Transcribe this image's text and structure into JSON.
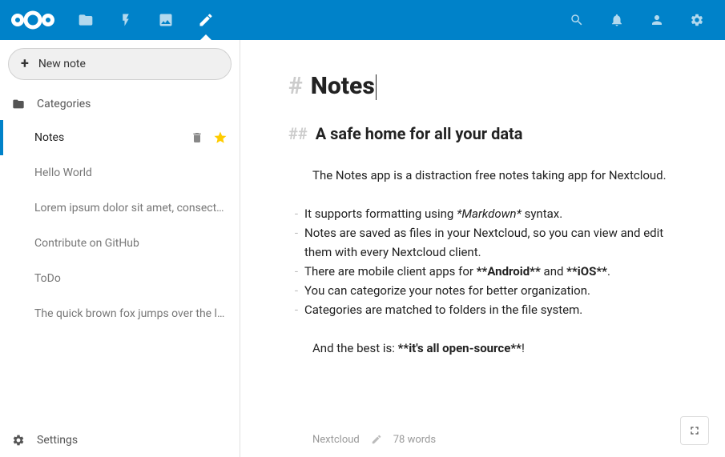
{
  "header": {
    "brand_color": "#0082c9"
  },
  "sidebar": {
    "new_note_label": "New note",
    "categories_label": "Categories",
    "settings_label": "Settings",
    "notes": [
      {
        "title": "Notes",
        "active": true,
        "starred": true
      },
      {
        "title": "Hello World"
      },
      {
        "title": "Lorem ipsum dolor sit amet, consectetur …"
      },
      {
        "title": "Contribute on GitHub"
      },
      {
        "title": "ToDo"
      },
      {
        "title": "The quick brown fox jumps over the loazy…"
      }
    ]
  },
  "editor": {
    "h1_marker": "#",
    "h1_text": "Notes",
    "h2_marker": "##",
    "h2_text": "A safe home for all your data",
    "intro": "The Notes app is a distraction free notes taking app for Nextcloud.",
    "bullets": [
      {
        "pre": "It supports formatting using ",
        "em": "*Markdown*",
        "post": " syntax."
      },
      {
        "pre": "Notes are saved as files in your Nextcloud, so you can view and edit them with every Nextcloud client."
      },
      {
        "pre": "There are mobile client apps for ",
        "b1": "**Android**",
        "mid": " and ",
        "b2": "**iOS**",
        "post": "."
      },
      {
        "pre": "You can categorize your notes for better organization."
      },
      {
        "pre": "Categories are matched to folders in the file system."
      }
    ],
    "outro_pre": "And the best is: ",
    "outro_bold": "**it's all open-source**",
    "outro_post": "!"
  },
  "footer": {
    "category": "Nextcloud",
    "wordcount": "78 words"
  }
}
